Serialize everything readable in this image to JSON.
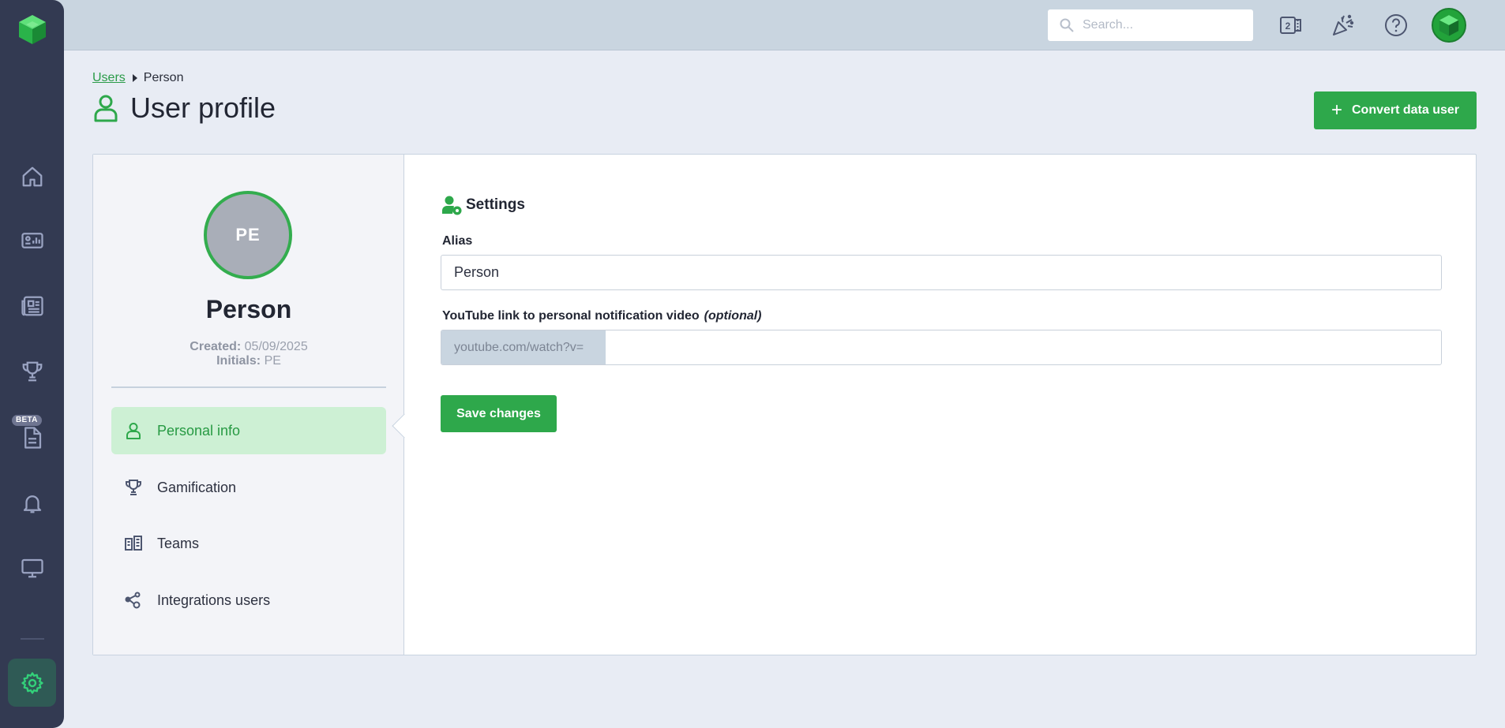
{
  "colors": {
    "rail_bg": "#333a52",
    "topbar_bg": "#c9d5e0",
    "page_bg": "#e8ecf4",
    "accent_green": "#2ea84b",
    "active_nav_bg": "#cdf0d4",
    "rail_icon": "#9aa3c2",
    "settings_icon": "#33d17a"
  },
  "rail": {
    "logo_icon": "green-cube-logo-icon",
    "items": [
      {
        "icon": "home-icon"
      },
      {
        "icon": "dashboard-card-icon"
      },
      {
        "icon": "news-icon"
      },
      {
        "icon": "trophy-icon"
      },
      {
        "icon": "document-icon",
        "badge": "BETA"
      },
      {
        "icon": "bell-icon"
      },
      {
        "icon": "monitor-icon"
      }
    ],
    "settings_icon": "gear-icon"
  },
  "topbar": {
    "search_placeholder": "Search...",
    "icons": [
      "tv-number-icon",
      "party-popper-icon",
      "help-icon"
    ],
    "avatar_icon": "green-cube-avatar-icon"
  },
  "breadcrumb": {
    "parent": "Users",
    "current": "Person"
  },
  "page": {
    "title": "User profile",
    "convert_button": "Convert data user",
    "convert_plus": "+"
  },
  "profile": {
    "avatar_initials": "PE",
    "name": "Person",
    "created_label": "Created:",
    "created_value": "05/09/2025",
    "initials_label": "Initials:",
    "initials_value": "PE"
  },
  "nav": {
    "items": [
      {
        "label": "Personal info",
        "icon": "user-icon",
        "active": true
      },
      {
        "label": "Gamification",
        "icon": "trophy-icon",
        "active": false
      },
      {
        "label": "Teams",
        "icon": "teams-icon",
        "active": false
      },
      {
        "label": "Integrations users",
        "icon": "share-nodes-icon",
        "active": false
      }
    ]
  },
  "settings": {
    "title": "Settings",
    "alias_label": "Alias",
    "alias_value": "Person",
    "youtube_label": "YouTube link to personal notification video",
    "youtube_optional": "(optional)",
    "youtube_prefix": "youtube.com/watch?v=",
    "youtube_value": "",
    "save_button": "Save changes"
  }
}
